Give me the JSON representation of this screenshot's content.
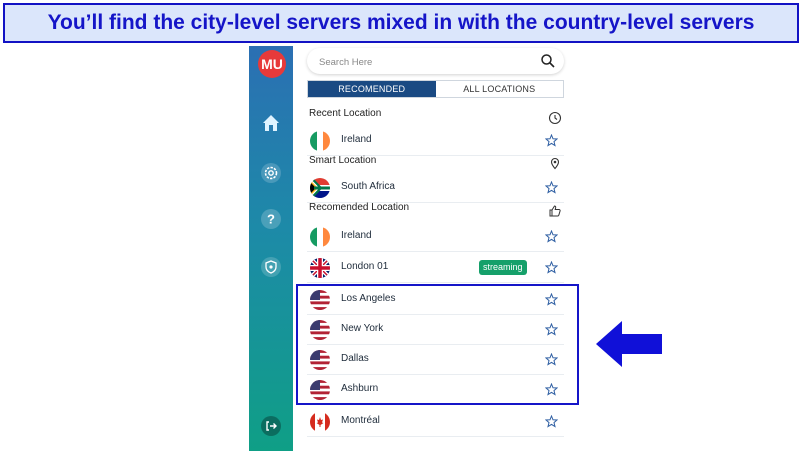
{
  "banner": {
    "text": "You’ll find the city-level servers mixed in with the country-level servers"
  },
  "sidebar": {
    "avatar_initials": "MU",
    "icons": [
      "home-icon",
      "settings-icon",
      "help-icon",
      "shield-icon",
      "logout-icon"
    ]
  },
  "search": {
    "placeholder": "Search Here"
  },
  "tabs": [
    {
      "label": "RECOMENDED",
      "active": true
    },
    {
      "label": "ALL LOCATIONS",
      "active": false
    }
  ],
  "sections": {
    "recent": "Recent Location",
    "smart": "Smart Location",
    "recommended": "Recomended Location"
  },
  "locations": {
    "recent_ireland": "Ireland",
    "smart_south_africa": "South Africa",
    "rec_ireland": "Ireland",
    "london": "London 01",
    "los_angeles": "Los Angeles",
    "new_york": "New York",
    "dallas": "Dallas",
    "ashburn": "Ashburn",
    "montreal": "Montréal"
  },
  "badges": {
    "london": "streaming"
  },
  "colors": {
    "banner_text": "#1515c8",
    "highlight": "#1515c8",
    "active_tab": "#1a4a83",
    "streaming_badge": "#15a06a",
    "avatar": "#e73a3a"
  }
}
